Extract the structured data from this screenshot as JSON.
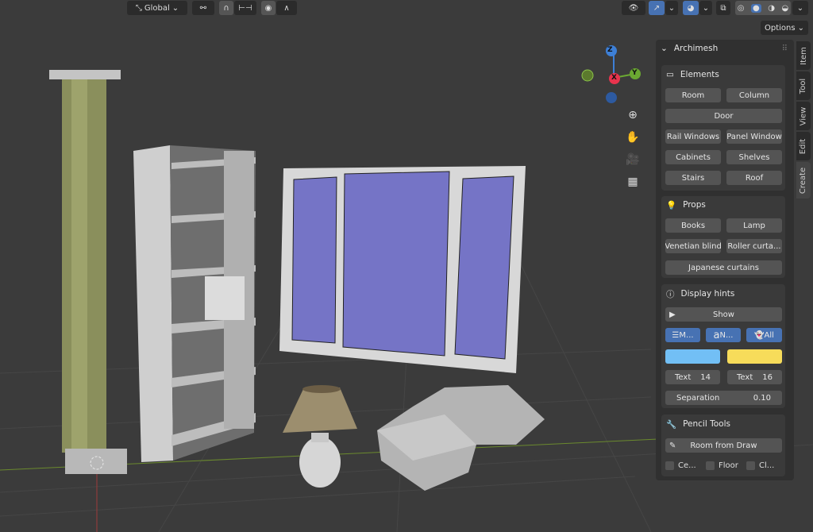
{
  "header": {
    "orientation": "Global",
    "options": "Options"
  },
  "tabs": [
    "Item",
    "Tool",
    "View",
    "Edit",
    "Create"
  ],
  "panel": {
    "title": "Archimesh",
    "elements": {
      "title": "Elements",
      "buttons": [
        "Room",
        "Column",
        "Door",
        "Rail Windows",
        "Panel Window",
        "Cabinets",
        "Shelves",
        "Stairs",
        "Roof"
      ]
    },
    "props": {
      "title": "Props",
      "buttons": [
        "Books",
        "Lamp",
        "Venetian blind",
        "Roller curta...",
        "Japanese curtains"
      ]
    },
    "hints": {
      "title": "Display hints",
      "show": "Show",
      "toggles": [
        "M...",
        "N...",
        "All"
      ],
      "color1": "#72bff5",
      "color2": "#f7dc5a",
      "text1_label": "Text",
      "text1_value": "14",
      "text2_label": "Text",
      "text2_value": "16",
      "sep_label": "Separation",
      "sep_value": "0.10"
    },
    "pencil": {
      "title": "Pencil Tools",
      "room_from_draw": "Room from Draw",
      "checks": [
        "Ce...",
        "Floor",
        "Cl..."
      ]
    }
  },
  "gizmo": {
    "z": "Z",
    "y": "Y",
    "x": "X"
  }
}
